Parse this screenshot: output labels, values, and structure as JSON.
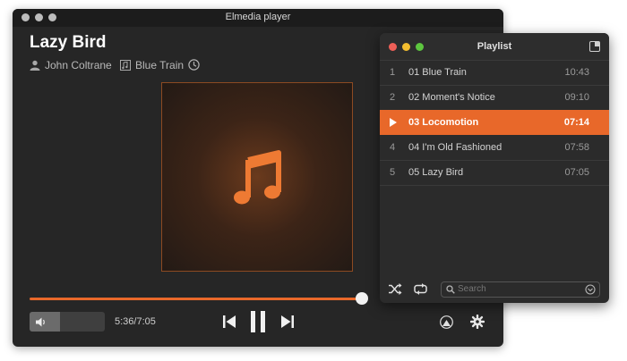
{
  "window": {
    "title": "Elmedia player"
  },
  "track": {
    "title": "Lazy Bird",
    "artist": "John Coltrane",
    "album": "Blue Train"
  },
  "playback": {
    "time_display": "5:36/7:05",
    "progress": 0.79,
    "volume": 0.4
  },
  "playlist": {
    "title": "Playlist",
    "search_placeholder": "Search",
    "items": [
      {
        "num": "1",
        "name": "01 Blue Train",
        "duration": "10:43"
      },
      {
        "num": "2",
        "name": "02 Moment's Notice",
        "duration": "09:10"
      },
      {
        "num": "",
        "name": "03 Locomotion",
        "duration": "07:14",
        "active": true
      },
      {
        "num": "4",
        "name": "04 I'm Old Fashioned",
        "duration": "07:58"
      },
      {
        "num": "5",
        "name": "05 Lazy Bird",
        "duration": "07:05"
      }
    ]
  },
  "colors": {
    "accent": "#e8682a",
    "background": "#262626"
  },
  "icons": [
    "close-dot",
    "minimize-dot",
    "zoom-dot",
    "person-icon",
    "album-icon",
    "clock-icon",
    "music-note-icon",
    "volume-icon",
    "previous-icon",
    "pause-icon",
    "next-icon",
    "airplay-icon",
    "gear-icon",
    "shuffle-icon",
    "repeat-icon",
    "search-icon",
    "dropdown-icon",
    "play-indicator-icon"
  ]
}
